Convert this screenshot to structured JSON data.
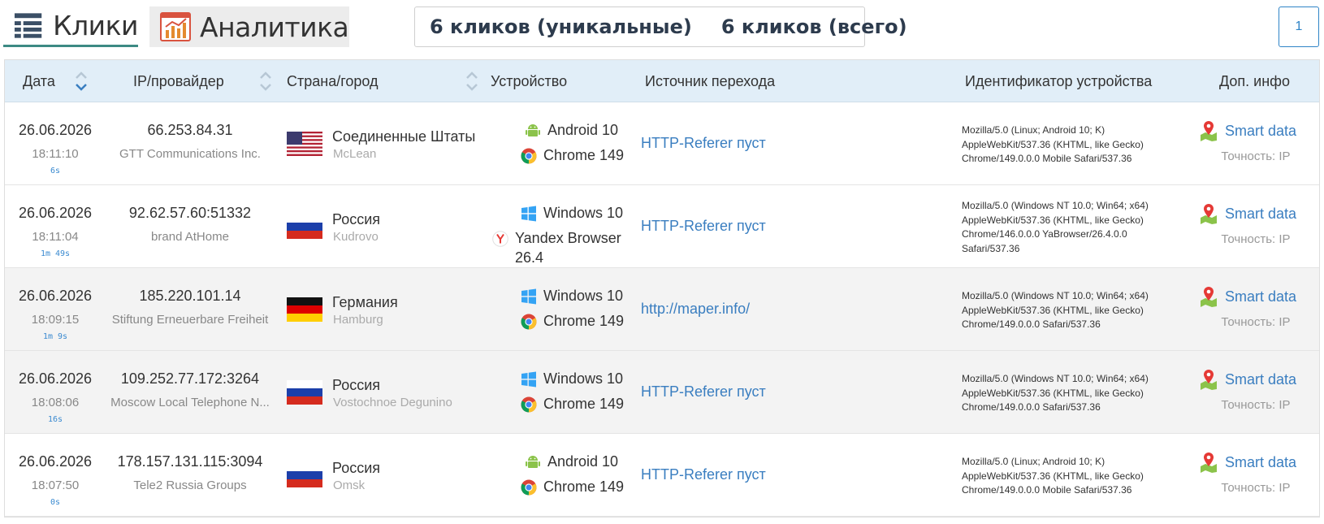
{
  "tabs": [
    {
      "label": "Клики",
      "active": true
    },
    {
      "label": "Аналитика",
      "active": false
    }
  ],
  "counters": {
    "unique": "6 кликов (уникальные)",
    "total": "6 кликов (всего)"
  },
  "pagination": {
    "current_page": "1"
  },
  "table": {
    "columns": [
      "Дата",
      "IP/провайдер",
      "Страна/город",
      "Устройство",
      "Источник перехода",
      "Идентификатор устройства",
      "Доп. инфо"
    ],
    "rows": [
      {
        "date": "26.06.2026",
        "time": "18:11:10",
        "delta": "6s",
        "ip": "66.253.84.31",
        "provider": "GTT Communications Inc.",
        "country": "Соединенные Штаты",
        "city": "McLean",
        "flag": "us-flag",
        "os": "Android 10",
        "os_icon": "android-icon",
        "browser": "Chrome 149",
        "browser_icon": "chrome-icon",
        "referer": "HTTP-Referer пуст",
        "ua": [
          "Mozilla/5.0 (Linux; Android 10; K)",
          "AppleWebKit/537.36 (KHTML, like Gecko)",
          "Chrome/149.0.0.0 Mobile Safari/537.36"
        ],
        "smart": "Smart data",
        "accuracy": "Точность: IP"
      },
      {
        "date": "26.06.2026",
        "time": "18:11:04",
        "delta": "1m 49s",
        "ip": "92.62.57.60:51332",
        "provider": "brand AtHome",
        "country": "Россия",
        "city": "Kudrovo",
        "flag": "ru-flag",
        "os": "Windows 10",
        "os_icon": "windows-icon",
        "browser": "Yandex Browser",
        "browser_version": "26.4",
        "browser_icon": "yandex-icon",
        "referer": "HTTP-Referer пуст",
        "ua": [
          "Mozilla/5.0 (Windows NT 10.0; Win64; x64)",
          "AppleWebKit/537.36 (KHTML, like Gecko)",
          "Chrome/146.0.0.0 YaBrowser/26.4.0.0",
          "Safari/537.36"
        ],
        "smart": "Smart data",
        "accuracy": "Точность: IP"
      },
      {
        "date": "26.06.2026",
        "time": "18:09:15",
        "delta": "1m 9s",
        "ip": "185.220.101.14",
        "provider": "Stiftung Erneuerbare Freiheit",
        "country": "Германия",
        "city": "Hamburg",
        "flag": "de-flag",
        "os": "Windows 10",
        "os_icon": "windows-icon",
        "browser": "Chrome 149",
        "browser_icon": "chrome-icon",
        "referer": "http://maper.info/",
        "ua": [
          "Mozilla/5.0 (Windows NT 10.0; Win64; x64)",
          "AppleWebKit/537.36 (KHTML, like Gecko)",
          "Chrome/149.0.0.0 Safari/537.36"
        ],
        "smart": "Smart data",
        "accuracy": "Точность: IP"
      },
      {
        "date": "26.06.2026",
        "time": "18:08:06",
        "delta": "16s",
        "ip": "109.252.77.172:3264",
        "provider": "Moscow Local Telephone N...",
        "country": "Россия",
        "city": "Vostochnoe Degunino",
        "flag": "ru-flag",
        "os": "Windows 10",
        "os_icon": "windows-icon",
        "browser": "Chrome 149",
        "browser_icon": "chrome-icon",
        "referer": "HTTP-Referer пуст",
        "ua": [
          "Mozilla/5.0 (Windows NT 10.0; Win64; x64)",
          "AppleWebKit/537.36 (KHTML, like Gecko)",
          "Chrome/149.0.0.0 Safari/537.36"
        ],
        "smart": "Smart data",
        "accuracy": "Точность: IP"
      },
      {
        "date": "26.06.2026",
        "time": "18:07:50",
        "delta": "0s",
        "ip": "178.157.131.115:3094",
        "provider": "Tele2 Russia Groups",
        "country": "Россия",
        "city": "Omsk",
        "flag": "ru-flag",
        "os": "Android 10",
        "os_icon": "android-icon",
        "browser": "Chrome 149",
        "browser_icon": "chrome-icon",
        "referer": "HTTP-Referer пуст",
        "ua": [
          "Mozilla/5.0 (Linux; Android 10; K)",
          "AppleWebKit/537.36 (KHTML, like Gecko)",
          "Chrome/149.0.0.0 Mobile Safari/537.36"
        ],
        "smart": "Smart data",
        "accuracy": "Точность: IP"
      }
    ]
  },
  "colors": {
    "accent_teal": "#3d8a84",
    "link_blue": "#3a7ec0",
    "header_bg": "#e1eef8",
    "alt_row_bg": "#f3f3f3"
  }
}
